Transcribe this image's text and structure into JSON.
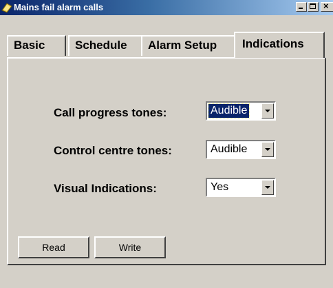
{
  "window": {
    "title": "Mains fail alarm calls",
    "icon": "app-icon"
  },
  "tabs": [
    {
      "label": "Basic",
      "active": false
    },
    {
      "label": "Schedule",
      "active": false
    },
    {
      "label": "Alarm Setup",
      "active": false
    },
    {
      "label": "Indications",
      "active": true
    }
  ],
  "fields": [
    {
      "label": "Call progress tones:",
      "value": "Audible",
      "focused": true
    },
    {
      "label": "Control centre tones:",
      "value": "Audible",
      "focused": false
    },
    {
      "label": "Visual Indications:",
      "value": "Yes",
      "focused": false
    }
  ],
  "buttons": {
    "read": "Read",
    "write": "Write"
  },
  "colors": {
    "face": "#d4d0c8",
    "titlebar": "#0a246a",
    "selection": "#0a246a"
  }
}
